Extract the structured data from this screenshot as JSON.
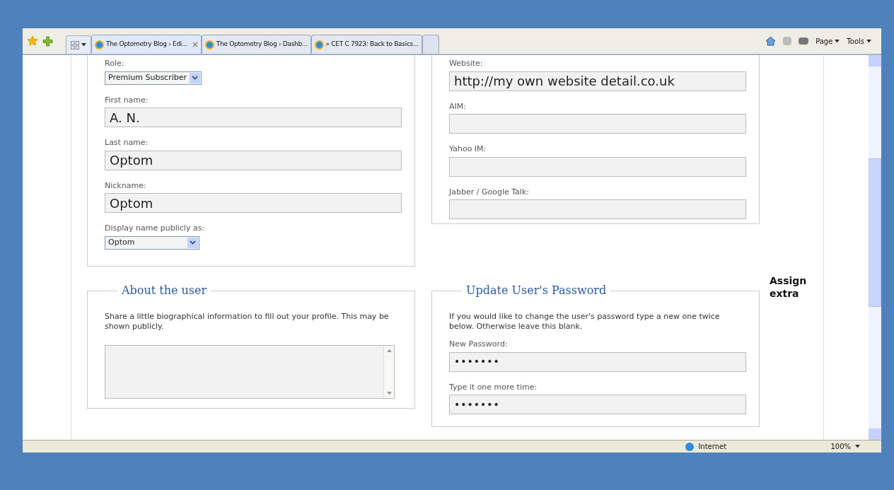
{
  "browser": {
    "tabs": [
      {
        "label": "The Optometry Blog › Edi...",
        "selected": true
      },
      {
        "label": "The Optometry Blog › Dashb...",
        "selected": false
      },
      {
        "label": "» CET C 7923: Back to Basics...",
        "selected": false
      }
    ],
    "toolbar": [
      "Page",
      "Tools"
    ],
    "status_bar": {
      "zone": "Internet",
      "zoom": "100%"
    }
  },
  "name_section": {
    "fields": [
      {
        "kind": "select",
        "label": "Role:",
        "value": "Premium Subscriber"
      },
      {
        "kind": "text",
        "label": "First name:",
        "value": "A. N."
      },
      {
        "kind": "text",
        "label": "Last name:",
        "value": "Optom"
      },
      {
        "kind": "text",
        "label": "Nickname:",
        "value": "Optom"
      },
      {
        "kind": "select",
        "label": "Display name publicly as:",
        "value": "Optom"
      }
    ]
  },
  "contact_section": {
    "fields": [
      {
        "kind": "text",
        "label": "Website:",
        "value": "http://my own website detail.co.uk"
      },
      {
        "kind": "text",
        "label": "AIM:"
      },
      {
        "kind": "text",
        "label": "Yahoo IM:"
      },
      {
        "kind": "text",
        "label": "Jabber / Google Talk:"
      }
    ]
  },
  "about_section": {
    "title": "About the user",
    "description": "Share a little biographical information to fill out your profile. This may be shown publicly."
  },
  "password_section": {
    "title": "Update User's Password",
    "description": "If you would like to change the user's password type a new one twice below. Otherwise leave this blank.",
    "fields": [
      {
        "kind": "password",
        "label": "New Password:",
        "value": "•••••••"
      },
      {
        "kind": "password",
        "label": "Type it one more time:",
        "value": "•••••••"
      }
    ]
  },
  "side_heading": "Assign extra"
}
